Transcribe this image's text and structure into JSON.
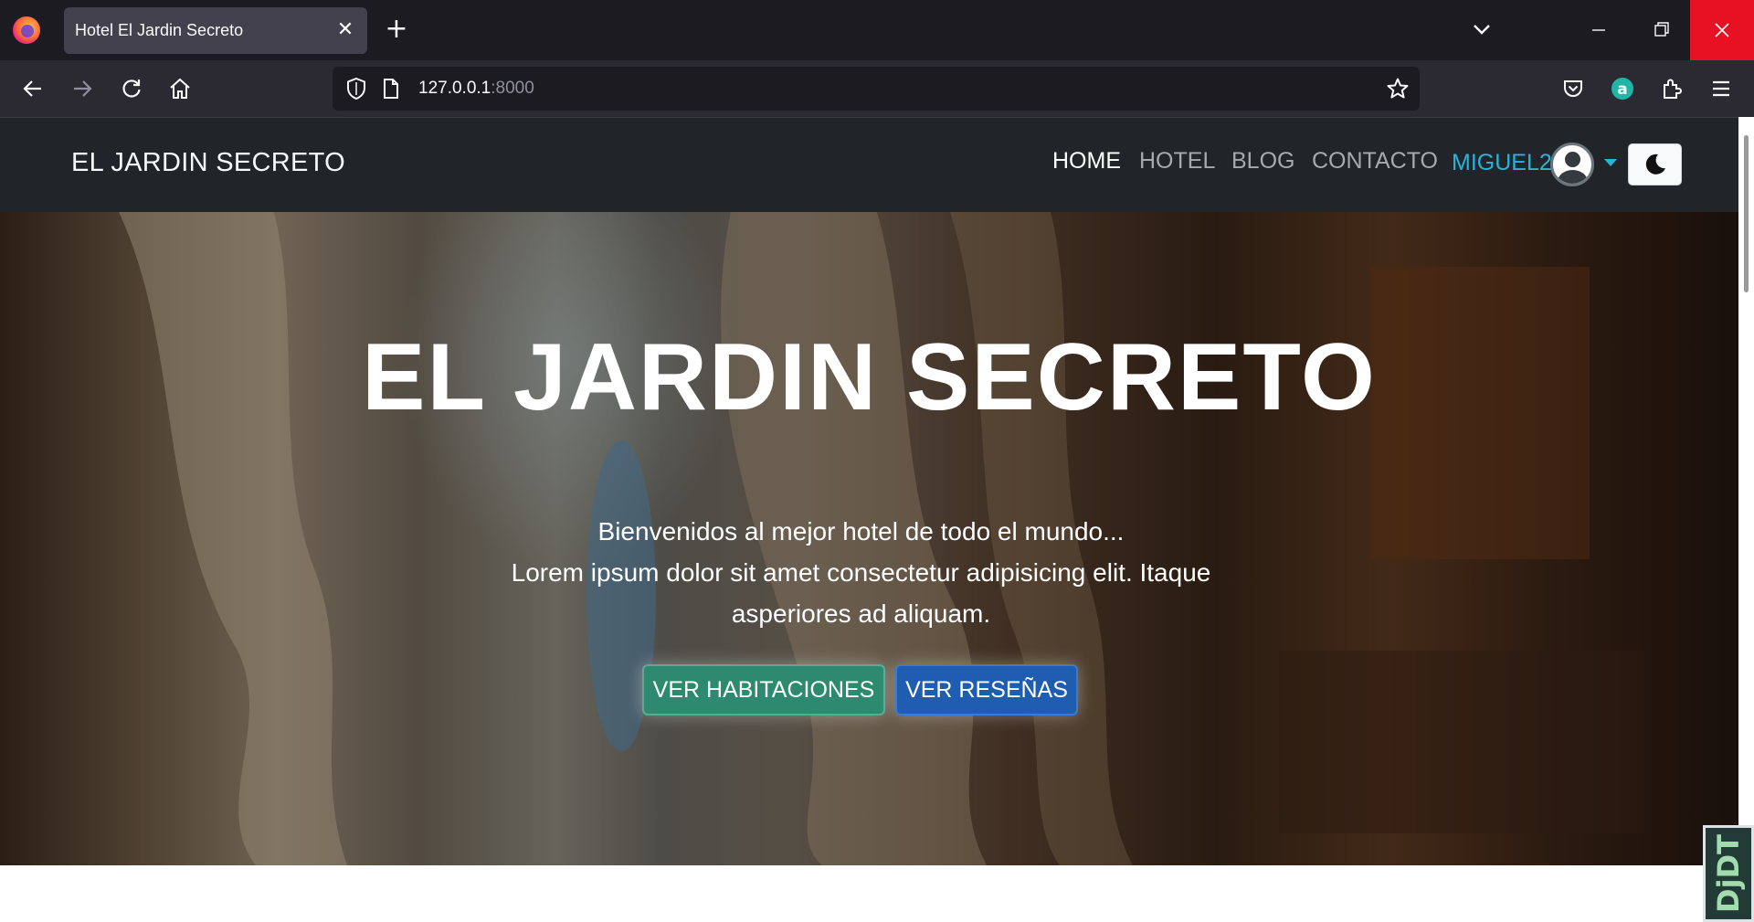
{
  "browser": {
    "tab_title": "Hotel El Jardin Secreto",
    "url_host": "127.0.0.1",
    "url_port": ":8000"
  },
  "site": {
    "brand": "EL JARDIN SECRETO",
    "menu": [
      "HOME",
      "HOTEL",
      "BLOG",
      "CONTACTO"
    ],
    "user": "MIGUEL2"
  },
  "hero": {
    "title": "EL JARDIN SECRETO",
    "line1": "Bienvenidos al mejor hotel de todo el mundo...",
    "line2": "Lorem ipsum dolor sit amet consectetur adipisicing elit. Itaque asperiores ad aliquam.",
    "btn_rooms": "VER HABITACIONES",
    "btn_reviews": "VER RESEÑAS"
  },
  "debug_toolbar": "DjDT",
  "colors": {
    "accent_user": "#27b4d8",
    "btn_rooms": "#2e8a6e",
    "btn_reviews": "#1f5db0",
    "window_close": "#e81123"
  }
}
